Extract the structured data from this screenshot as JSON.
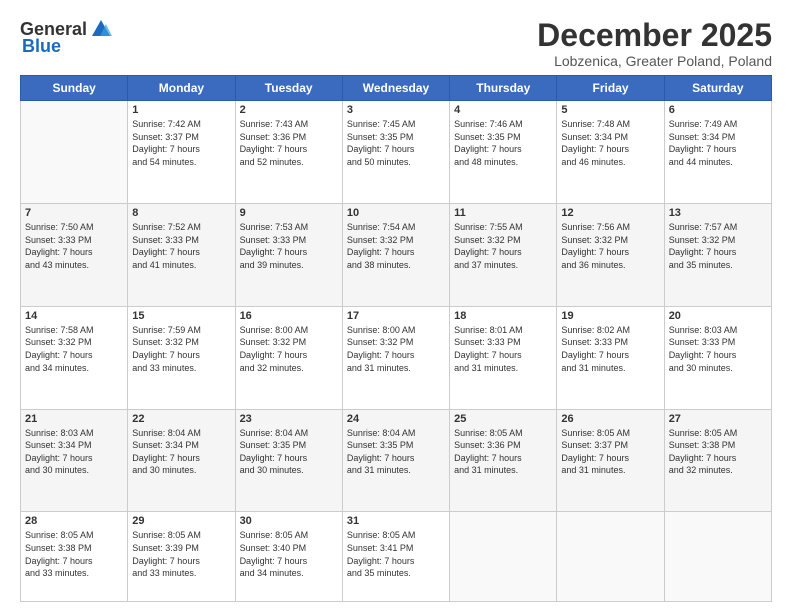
{
  "logo": {
    "general": "General",
    "blue": "Blue"
  },
  "title": "December 2025",
  "location": "Lobzenica, Greater Poland, Poland",
  "weekdays": [
    "Sunday",
    "Monday",
    "Tuesday",
    "Wednesday",
    "Thursday",
    "Friday",
    "Saturday"
  ],
  "weeks": [
    [
      {
        "day": "",
        "info": ""
      },
      {
        "day": "1",
        "info": "Sunrise: 7:42 AM\nSunset: 3:37 PM\nDaylight: 7 hours\nand 54 minutes."
      },
      {
        "day": "2",
        "info": "Sunrise: 7:43 AM\nSunset: 3:36 PM\nDaylight: 7 hours\nand 52 minutes."
      },
      {
        "day": "3",
        "info": "Sunrise: 7:45 AM\nSunset: 3:35 PM\nDaylight: 7 hours\nand 50 minutes."
      },
      {
        "day": "4",
        "info": "Sunrise: 7:46 AM\nSunset: 3:35 PM\nDaylight: 7 hours\nand 48 minutes."
      },
      {
        "day": "5",
        "info": "Sunrise: 7:48 AM\nSunset: 3:34 PM\nDaylight: 7 hours\nand 46 minutes."
      },
      {
        "day": "6",
        "info": "Sunrise: 7:49 AM\nSunset: 3:34 PM\nDaylight: 7 hours\nand 44 minutes."
      }
    ],
    [
      {
        "day": "7",
        "info": "Sunrise: 7:50 AM\nSunset: 3:33 PM\nDaylight: 7 hours\nand 43 minutes."
      },
      {
        "day": "8",
        "info": "Sunrise: 7:52 AM\nSunset: 3:33 PM\nDaylight: 7 hours\nand 41 minutes."
      },
      {
        "day": "9",
        "info": "Sunrise: 7:53 AM\nSunset: 3:33 PM\nDaylight: 7 hours\nand 39 minutes."
      },
      {
        "day": "10",
        "info": "Sunrise: 7:54 AM\nSunset: 3:32 PM\nDaylight: 7 hours\nand 38 minutes."
      },
      {
        "day": "11",
        "info": "Sunrise: 7:55 AM\nSunset: 3:32 PM\nDaylight: 7 hours\nand 37 minutes."
      },
      {
        "day": "12",
        "info": "Sunrise: 7:56 AM\nSunset: 3:32 PM\nDaylight: 7 hours\nand 36 minutes."
      },
      {
        "day": "13",
        "info": "Sunrise: 7:57 AM\nSunset: 3:32 PM\nDaylight: 7 hours\nand 35 minutes."
      }
    ],
    [
      {
        "day": "14",
        "info": "Sunrise: 7:58 AM\nSunset: 3:32 PM\nDaylight: 7 hours\nand 34 minutes."
      },
      {
        "day": "15",
        "info": "Sunrise: 7:59 AM\nSunset: 3:32 PM\nDaylight: 7 hours\nand 33 minutes."
      },
      {
        "day": "16",
        "info": "Sunrise: 8:00 AM\nSunset: 3:32 PM\nDaylight: 7 hours\nand 32 minutes."
      },
      {
        "day": "17",
        "info": "Sunrise: 8:00 AM\nSunset: 3:32 PM\nDaylight: 7 hours\nand 31 minutes."
      },
      {
        "day": "18",
        "info": "Sunrise: 8:01 AM\nSunset: 3:33 PM\nDaylight: 7 hours\nand 31 minutes."
      },
      {
        "day": "19",
        "info": "Sunrise: 8:02 AM\nSunset: 3:33 PM\nDaylight: 7 hours\nand 31 minutes."
      },
      {
        "day": "20",
        "info": "Sunrise: 8:03 AM\nSunset: 3:33 PM\nDaylight: 7 hours\nand 30 minutes."
      }
    ],
    [
      {
        "day": "21",
        "info": "Sunrise: 8:03 AM\nSunset: 3:34 PM\nDaylight: 7 hours\nand 30 minutes."
      },
      {
        "day": "22",
        "info": "Sunrise: 8:04 AM\nSunset: 3:34 PM\nDaylight: 7 hours\nand 30 minutes."
      },
      {
        "day": "23",
        "info": "Sunrise: 8:04 AM\nSunset: 3:35 PM\nDaylight: 7 hours\nand 30 minutes."
      },
      {
        "day": "24",
        "info": "Sunrise: 8:04 AM\nSunset: 3:35 PM\nDaylight: 7 hours\nand 31 minutes."
      },
      {
        "day": "25",
        "info": "Sunrise: 8:05 AM\nSunset: 3:36 PM\nDaylight: 7 hours\nand 31 minutes."
      },
      {
        "day": "26",
        "info": "Sunrise: 8:05 AM\nSunset: 3:37 PM\nDaylight: 7 hours\nand 31 minutes."
      },
      {
        "day": "27",
        "info": "Sunrise: 8:05 AM\nSunset: 3:38 PM\nDaylight: 7 hours\nand 32 minutes."
      }
    ],
    [
      {
        "day": "28",
        "info": "Sunrise: 8:05 AM\nSunset: 3:38 PM\nDaylight: 7 hours\nand 33 minutes."
      },
      {
        "day": "29",
        "info": "Sunrise: 8:05 AM\nSunset: 3:39 PM\nDaylight: 7 hours\nand 33 minutes."
      },
      {
        "day": "30",
        "info": "Sunrise: 8:05 AM\nSunset: 3:40 PM\nDaylight: 7 hours\nand 34 minutes."
      },
      {
        "day": "31",
        "info": "Sunrise: 8:05 AM\nSunset: 3:41 PM\nDaylight: 7 hours\nand 35 minutes."
      },
      {
        "day": "",
        "info": ""
      },
      {
        "day": "",
        "info": ""
      },
      {
        "day": "",
        "info": ""
      }
    ]
  ]
}
